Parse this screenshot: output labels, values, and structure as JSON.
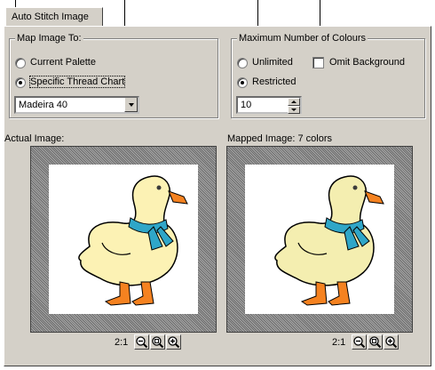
{
  "tab": {
    "label": "Auto Stitch Image"
  },
  "map_group": {
    "title": "Map Image To:",
    "current_palette": {
      "label": "Current Palette",
      "selected": false
    },
    "specific_chart": {
      "label": "Specific Thread Chart",
      "selected": true
    },
    "chart_select": {
      "value": "Madeira 40"
    }
  },
  "colours_group": {
    "title": "Maximum Number of Colours",
    "unlimited": {
      "label": "Unlimited",
      "selected": false
    },
    "restricted": {
      "label": "Restricted",
      "selected": true
    },
    "omit_background": {
      "label": "Omit Background",
      "checked": false
    },
    "count": {
      "value": "10"
    }
  },
  "actual": {
    "label": "Actual Image:",
    "zoom_text": "2:1"
  },
  "mapped": {
    "label": "Mapped Image: 7 colors",
    "zoom_text": "2:1"
  },
  "colors": {
    "body_actual": "#fcf2b4",
    "body_mapped": "#f4eeb0",
    "scarf": "#2fa6c8",
    "beak": "#f58220",
    "face": "#3b3b3b",
    "panel": "#d4d0c8"
  },
  "icons": {
    "zoom_out": "zoom-out-icon",
    "zoom_fit": "zoom-fit-icon",
    "zoom_in": "zoom-in-icon"
  }
}
